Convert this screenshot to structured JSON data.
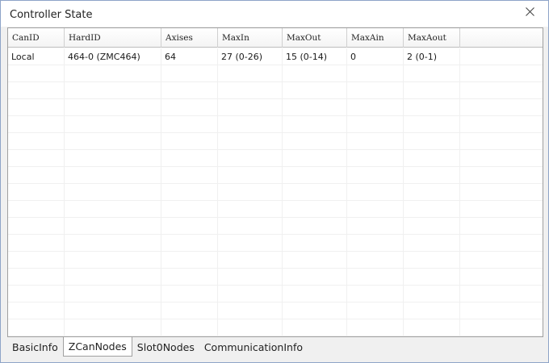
{
  "window": {
    "title": "Controller State"
  },
  "table": {
    "columns": [
      {
        "label": "CanID",
        "w": 70
      },
      {
        "label": "HardID",
        "w": 120
      },
      {
        "label": "Axises",
        "w": 70
      },
      {
        "label": "MaxIn",
        "w": 80
      },
      {
        "label": "MaxOut",
        "w": 80
      },
      {
        "label": "MaxAin",
        "w": 70
      },
      {
        "label": "MaxAout",
        "w": 70
      }
    ],
    "rows": [
      [
        "Local",
        "464-0 (ZMC464)",
        "64",
        "27 (0-26)",
        "15 (0-14)",
        "0",
        "2 (0-1)"
      ]
    ]
  },
  "tabs": [
    {
      "label": "BasicInfo",
      "active": false
    },
    {
      "label": "ZCanNodes",
      "active": true
    },
    {
      "label": "Slot0Nodes",
      "active": false
    },
    {
      "label": "CommunicationInfo",
      "active": false
    }
  ]
}
